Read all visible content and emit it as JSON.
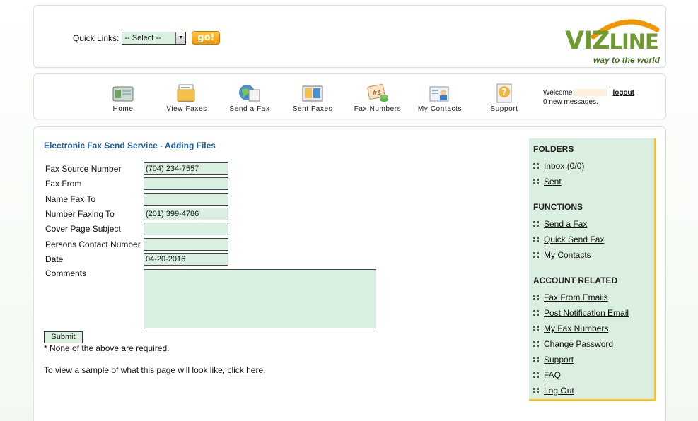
{
  "quick_links": {
    "label": "Quick Links:",
    "selected": "-- Select --",
    "go_label": "go!"
  },
  "logo": {
    "name_part1": "Viz",
    "name_part2": "Line",
    "tagline": "way to the world",
    "brand_green": "#6e9b2e",
    "swoosh_orange": "#f29600"
  },
  "nav": {
    "items": [
      {
        "label": "Home",
        "icon": "home-icon"
      },
      {
        "label": "View Faxes",
        "icon": "view-faxes-icon"
      },
      {
        "label": "Send a Fax",
        "icon": "send-fax-icon"
      },
      {
        "label": "Sent Faxes",
        "icon": "sent-faxes-icon"
      },
      {
        "label": "Fax Numbers",
        "icon": "fax-numbers-icon"
      },
      {
        "label": "My Contacts",
        "icon": "contacts-icon"
      },
      {
        "label": "Support",
        "icon": "support-icon"
      }
    ],
    "welcome": "Welcome",
    "separator": "|",
    "logout": "logout",
    "messages": "0 new messages."
  },
  "main": {
    "title": "Electronic Fax Send Service - Adding Files",
    "fields": [
      {
        "label": "Fax Source Number",
        "value": "(704) 234-7557"
      },
      {
        "label": "Fax From",
        "value": ""
      },
      {
        "label": "Name Fax To",
        "value": ""
      },
      {
        "label": "Number Faxing To",
        "value": "(201) 399-4786"
      },
      {
        "label": "Cover Page Subject",
        "value": ""
      },
      {
        "label": "Persons Contact Number",
        "value": ""
      },
      {
        "label": "Date",
        "value": "04-20-2016"
      }
    ],
    "comments_label": "Comments",
    "comments_value": "",
    "submit_label": "Submit",
    "note": "* None of the above are required.",
    "sample_text": "To view a sample of what this page will look like,",
    "sample_link": "click here",
    "sample_end": "."
  },
  "sidebar": {
    "folders_heading": "FOLDERS",
    "folders": [
      "Inbox (0/0)",
      "Sent"
    ],
    "functions_heading": "FUNCTIONS",
    "functions": [
      "Send a Fax",
      "Quick Send Fax",
      "My Contacts"
    ],
    "account_heading": "ACCOUNT RELATED",
    "account": [
      "Fax From Emails",
      "Post Notification Email",
      "My Fax Numbers",
      "Change Password",
      "Support",
      "FAQ",
      "Log Out"
    ],
    "panel_color": "#dbefe0",
    "accent_color": "#f1c232"
  }
}
